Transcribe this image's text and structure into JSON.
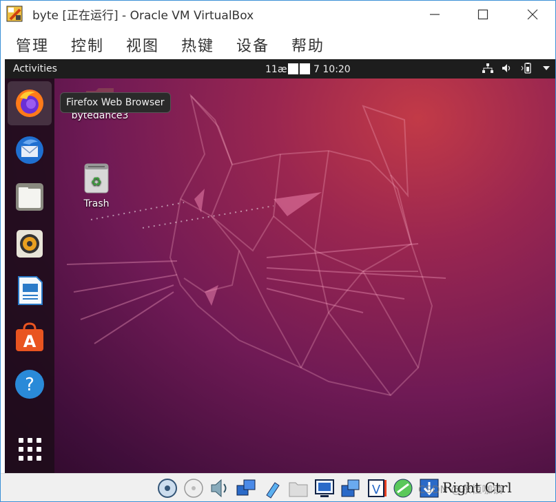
{
  "window": {
    "title": "byte [正在运行] - Oracle VM VirtualBox",
    "controls": [
      "minimize",
      "maximize",
      "close"
    ]
  },
  "menubar": {
    "items": [
      "管理",
      "控制",
      "视图",
      "热键",
      "设备",
      "帮助"
    ]
  },
  "gnome_topbar": {
    "activities": "Activities",
    "clock_prefix": "11æ",
    "clock_suffix": "7 10:20",
    "tray_icons": [
      "network-icon",
      "volume-icon",
      "battery-icon",
      "system-menu-arrow-icon"
    ]
  },
  "dock": {
    "items": [
      {
        "name": "firefox",
        "icon": "firefox-icon",
        "active": true
      },
      {
        "name": "thunderbird",
        "icon": "thunderbird-icon"
      },
      {
        "name": "files",
        "icon": "files-icon"
      },
      {
        "name": "rhythmbox",
        "icon": "rhythmbox-icon"
      },
      {
        "name": "libreoffice-writer",
        "icon": "writer-icon"
      },
      {
        "name": "ubuntu-software",
        "icon": "software-icon"
      },
      {
        "name": "help",
        "icon": "help-icon"
      },
      {
        "name": "show-applications",
        "icon": "app-grid-icon"
      }
    ],
    "tooltip": "Firefox Web Browser"
  },
  "desktop": {
    "icons": [
      {
        "label": "bytedance3",
        "icon": "folder-icon"
      },
      {
        "label": "Trash",
        "icon": "trash-icon"
      }
    ]
  },
  "statusbar": {
    "icons": [
      "hard-disk-icon",
      "optical-drive-icon",
      "audio-icon",
      "network-icon",
      "usb-icon",
      "shared-folder-icon",
      "display-icon",
      "capture-icon",
      "recording-icon",
      "cpu-icon",
      "mouse-integration-icon",
      "arrow-down-icon"
    ],
    "host_key": "Right Ctrl",
    "watermark": "CSDN @永恒咖锁"
  },
  "colors": {
    "wallpaper_accent": "#c23a47",
    "wallpaper_base": "#2c0a28",
    "tooltip_bg": "#2a2a2a",
    "topbar_bg": "#1d1d1d"
  }
}
